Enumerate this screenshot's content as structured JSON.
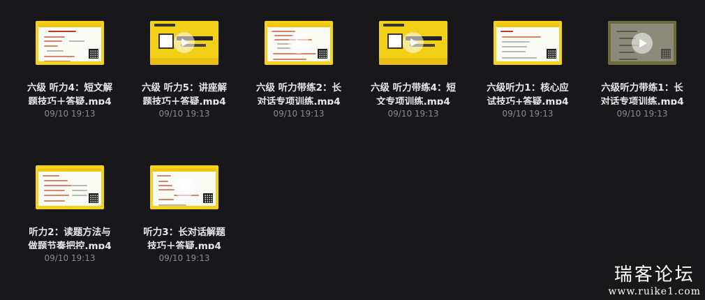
{
  "files": [
    {
      "title": "六级 听力4：短文解题技巧＋答疑.mp4",
      "date": "09/10 19:13",
      "thumb": "slide"
    },
    {
      "title": "六级 听力5：讲座解题技巧＋答疑.mp4",
      "date": "09/10 19:13",
      "thumb": "poster"
    },
    {
      "title": "六级 听力带练2：长对话专项训练.mp4",
      "date": "09/10 19:13",
      "thumb": "slide"
    },
    {
      "title": "六级 听力带练4：短文专项训练.mp4",
      "date": "09/10 19:13",
      "thumb": "poster"
    },
    {
      "title": "六级听力1：核心应试技巧+答疑.mp4",
      "date": "09/10 19:13",
      "thumb": "slide"
    },
    {
      "title": "六级听力带练1：长对话专项训练.mp4",
      "date": "09/10 19:13",
      "thumb": "dark"
    },
    {
      "title": "听力2：读题方法与做题节奏把控.mp4",
      "date": "09/10 19:13",
      "thumb": "slide"
    },
    {
      "title": "听力3：长对话解题技巧＋答疑.mp4",
      "date": "09/10 19:13",
      "thumb": "slide"
    }
  ],
  "watermark": {
    "main": "瑞客论坛",
    "url": "www.ruike1.com"
  }
}
